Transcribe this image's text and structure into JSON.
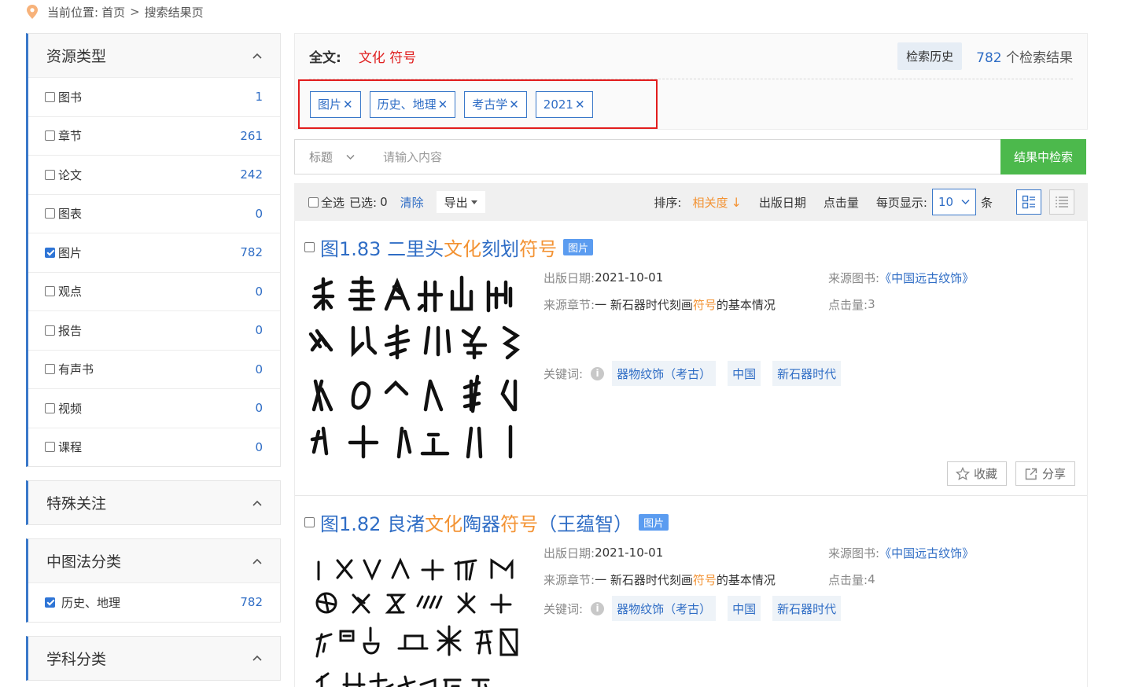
{
  "breadcrumb": {
    "prefix": "当前位置:",
    "home": "首页",
    "sep": ">",
    "current": "搜索结果页"
  },
  "sidebar": {
    "resource_type": {
      "title": "资源类型",
      "items": [
        {
          "label": "图书",
          "count": "1",
          "checked": false
        },
        {
          "label": "章节",
          "count": "261",
          "checked": false
        },
        {
          "label": "论文",
          "count": "242",
          "checked": false
        },
        {
          "label": "图表",
          "count": "0",
          "checked": false
        },
        {
          "label": "图片",
          "count": "782",
          "checked": true
        },
        {
          "label": "观点",
          "count": "0",
          "checked": false
        },
        {
          "label": "报告",
          "count": "0",
          "checked": false
        },
        {
          "label": "有声书",
          "count": "0",
          "checked": false
        },
        {
          "label": "视频",
          "count": "0",
          "checked": false
        },
        {
          "label": "课程",
          "count": "0",
          "checked": false
        }
      ]
    },
    "special": {
      "title": "特殊关注"
    },
    "clc": {
      "title": "中图法分类",
      "items": [
        {
          "label": "历史、地理",
          "count": "782",
          "checked": true
        }
      ]
    },
    "subject": {
      "title": "学科分类"
    }
  },
  "query": {
    "label": "全文:",
    "text": "文化 符号",
    "history_label": "检索历史",
    "count": "782",
    "count_suffix": " 个检索结果",
    "tags": [
      "图片",
      "历史、地理",
      "考古学",
      "2021"
    ],
    "tag_remove": "✕"
  },
  "search": {
    "field": "标题",
    "placeholder": "请输入内容",
    "button": "结果中检索"
  },
  "toolbar": {
    "select_all": "全选",
    "selected_label": "已选:",
    "selected_count": "0",
    "clear": "清除",
    "export": "导出",
    "sort_label": "排序:",
    "sort_active": "相关度",
    "sort_arrow": "↓",
    "sort_date": "出版日期",
    "sort_clicks": "点击量",
    "per_page_label": "每页显示:",
    "per_page_value": "10",
    "per_page_unit": "条"
  },
  "labels": {
    "pub_date": "出版日期:",
    "source_chapter": "来源章节:",
    "keywords": "关键词:",
    "source_book": "来源图书:",
    "clicks": "点击量:",
    "info": "i",
    "favorite": "收藏",
    "share": "分享"
  },
  "results": [
    {
      "title_pre": "图1.83 二里头",
      "title_hl1": "文化",
      "title_mid": "刻划",
      "title_hl2": "符号",
      "title_post": "",
      "badge": "图片",
      "pub_date": "2021-10-01",
      "chapter_pre": "一 新石器时代刻画",
      "chapter_hl": "符号",
      "chapter_post": "的基本情况",
      "source_book": "《中国远古纹饰》",
      "clicks": "3",
      "keywords": [
        "器物纹饰（考古）",
        "中国",
        "新石器时代"
      ]
    },
    {
      "title_pre": "图1.82 良渚",
      "title_hl1": "文化",
      "title_mid": "陶器",
      "title_hl2": "符号",
      "title_post": "（王蕴智）",
      "badge": "图片",
      "pub_date": "2021-10-01",
      "chapter_pre": "一 新石器时代刻画",
      "chapter_hl": "符号",
      "chapter_post": "的基本情况",
      "source_book": "《中国远古纹饰》",
      "clicks": "4",
      "keywords": [
        "器物纹饰（考古）",
        "中国",
        "新石器时代"
      ]
    }
  ]
}
